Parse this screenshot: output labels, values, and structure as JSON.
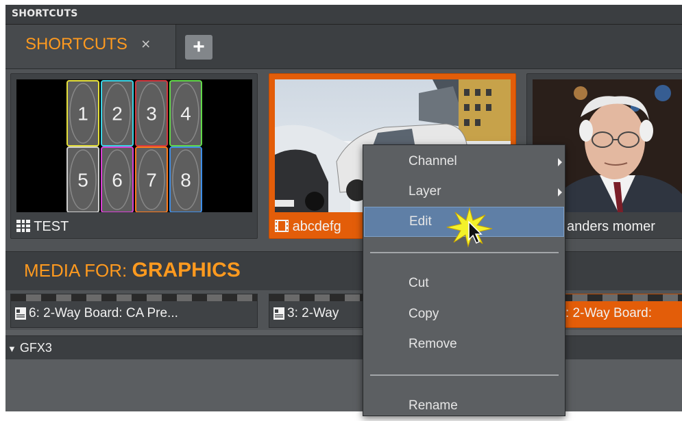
{
  "panel": {
    "title": "SHORTCUTS"
  },
  "tabs": [
    {
      "label": "SHORTCUTS",
      "close_glyph": "×"
    }
  ],
  "add_tab": {
    "glyph": "+"
  },
  "shortcuts": [
    {
      "label": "TEST",
      "icon": "grid-icon",
      "cells": [
        "1",
        "2",
        "3",
        "4",
        "5",
        "6",
        "7",
        "8"
      ],
      "cell_colors": [
        "#e7e23b",
        "#39d4e6",
        "#d4383f",
        "#62d94a",
        "#cfcfcf",
        "#d93ed4",
        "#ff7a1a",
        "#3e8ee8"
      ]
    },
    {
      "label": "abcdefg",
      "icon": "film-icon",
      "selected": true
    },
    {
      "label": "anders momer",
      "icon": ""
    }
  ],
  "media": {
    "title_prefix": "MEDIA FOR:",
    "title_main": "GRAPHICS",
    "items": [
      {
        "label": "6: 2-Way Board: CA   Pre...",
        "icon": "page-icon"
      },
      {
        "label": "3: 2-Way",
        "icon": "page-icon"
      },
      {
        "label": ": 2-Way Board:",
        "selected": true
      }
    ]
  },
  "group": {
    "label": "GFX3",
    "toggle": "expanded"
  },
  "context_menu": {
    "items": [
      {
        "label": "Channel",
        "submenu": true
      },
      {
        "label": "Layer",
        "submenu": true
      },
      {
        "label": "Edit",
        "highlighted": true
      },
      {
        "label": "Cut"
      },
      {
        "label": "Copy"
      },
      {
        "label": "Remove"
      },
      {
        "label": "Rename"
      }
    ]
  },
  "colors": {
    "accent": "#ff9a1f",
    "selected": "#e35d09",
    "menu_highlight": "#5f7fa6"
  }
}
